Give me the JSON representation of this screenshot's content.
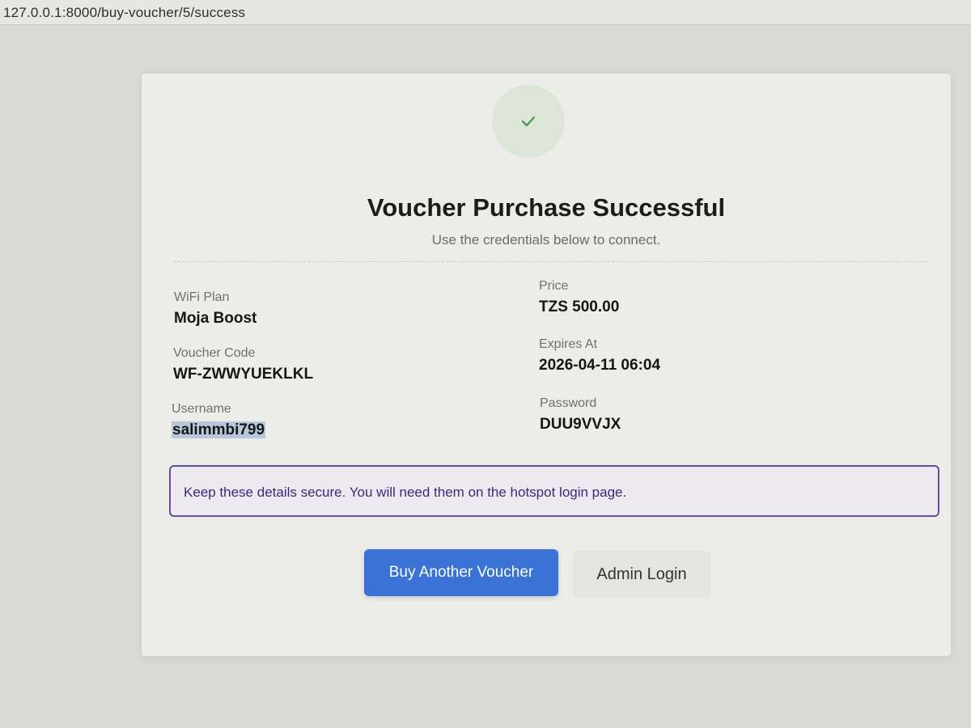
{
  "browser": {
    "url": "127.0.0.1:8000/buy-voucher/5/success"
  },
  "success": {
    "icon": "check-icon",
    "title": "Voucher Purchase Successful",
    "subtitle": "Use the credentials below to connect."
  },
  "details": {
    "plan": {
      "label": "WiFi Plan",
      "value": "Moja Boost"
    },
    "price": {
      "label": "Price",
      "value": "TZS 500.00"
    },
    "voucher": {
      "label": "Voucher Code",
      "value": "WF-ZWWYUEKLKL"
    },
    "expires": {
      "label": "Expires At",
      "value": "2026-04-11 06:04"
    },
    "username": {
      "label": "Username",
      "value": "salimmbi799"
    },
    "password": {
      "label": "Password",
      "value": "DUU9VVJX"
    }
  },
  "notice": {
    "text": "Keep these details secure. You will need them on the hotspot login page."
  },
  "actions": {
    "buy_another": "Buy Another Voucher",
    "admin_login": "Admin Login"
  },
  "colors": {
    "primary": "#3a72d6",
    "success": "#4c9a5a",
    "notice_border": "#6a4a9a"
  }
}
